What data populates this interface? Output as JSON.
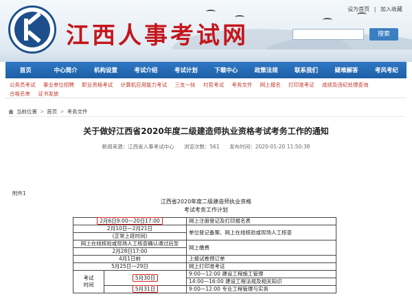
{
  "header": {
    "site_title": "江西人事考试网",
    "top_links": [
      "设为首页",
      "加入收藏"
    ],
    "search_button": "搜索"
  },
  "nav": {
    "items": [
      "首页",
      "中心简介",
      "机构设置",
      "考试介绍",
      "考试计划",
      "下载中心",
      "政策法规",
      "联系我们",
      "疑难解答",
      "考风考纪"
    ]
  },
  "subnav": {
    "items": [
      "公务员考试",
      "事业单位招聘",
      "职业资格考试",
      "计算机应用能力考试",
      "三支一扶",
      "村官考试",
      "考务文件",
      "网上报名",
      "打印准考证",
      "成绩及违纪处理查询",
      "合格名单",
      "证书发放"
    ]
  },
  "breadcrumb": {
    "label": "当前位置",
    "items": [
      "首页",
      "考务文件"
    ]
  },
  "article": {
    "title": "关于做好江西省2020年度二级建造师执业资格考试考务工作的通知",
    "source": "新闻来源：江西省人事考试中心",
    "views": "浏览次数：561",
    "time": "发布时间：2020-01-20 11:50:38"
  },
  "attachment": {
    "label": "附件1",
    "title_line1": "江西省2020年度二级建造师执业资格",
    "title_line2": "考试考务工作计划",
    "rows": [
      {
        "time": "2月6日9:00—20日17:00",
        "task": "网上注册登记及打印报名表",
        "highlight": true
      },
      {
        "time": "2月10日—2月21日",
        "task": "单位登记备案、网上在线核验或现场人工核查",
        "highlight": false
      },
      {
        "time": "(正常上班时间)",
        "task": "",
        "highlight": false
      },
      {
        "time": "网上在线核验或现场人工核查确认通过后至",
        "task": "网上缴费",
        "highlight": false
      },
      {
        "time": "2月28日17:00",
        "task": "",
        "highlight": false
      },
      {
        "time": "4月1日前",
        "task": "上报试卷预订单",
        "highlight": false
      },
      {
        "time": "5月25日—29日",
        "task": "网上打印准考证",
        "highlight": false
      }
    ],
    "exam": {
      "label_line1": "考试",
      "label_line2": "时间",
      "day1": "5月30日",
      "day1_sessions": [
        "9:00—12:00 建设工程施工管理",
        "14:00—16:00 建设工程法规及相关知识"
      ],
      "day2": "5月31日",
      "day2_sessions": [
        "9:00—12:00 专业工程管理与实务"
      ]
    }
  },
  "colors": {
    "brand_red": "#c4161c",
    "nav_blue": "#1c5fa6",
    "highlight_red": "#d21f1f"
  }
}
